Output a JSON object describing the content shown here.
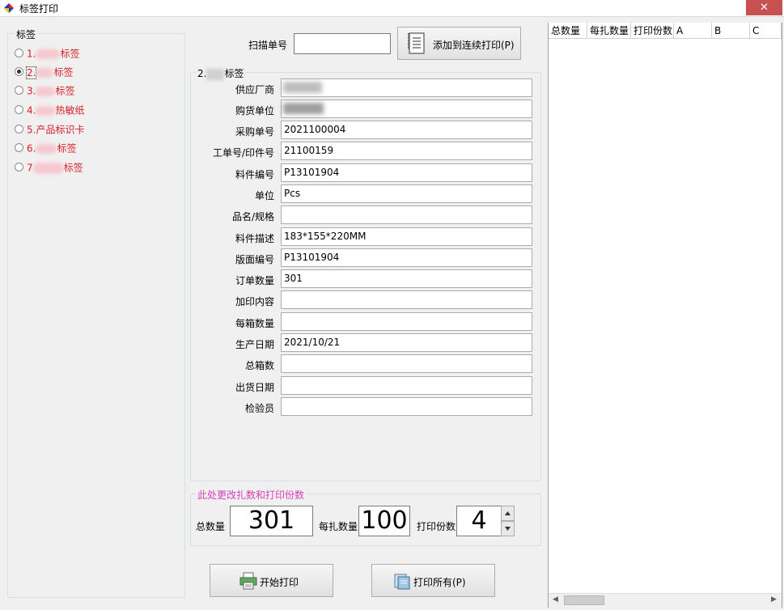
{
  "window": {
    "title": "标签打印",
    "close_symbol": "✕"
  },
  "label_group": {
    "legend": "标签",
    "items": [
      {
        "prefix": "1.",
        "suffix": "标签",
        "checked": false
      },
      {
        "prefix": "2.",
        "suffix": "标签",
        "checked": true
      },
      {
        "prefix": "3.",
        "suffix": "标签",
        "checked": false
      },
      {
        "prefix": "4.",
        "suffix": "热敏纸",
        "checked": false
      },
      {
        "prefix": "5.",
        "suffix": "产品标识卡",
        "checked": false
      },
      {
        "prefix": "6.",
        "suffix": "标签",
        "checked": false
      },
      {
        "prefix": "7",
        "suffix": "标签",
        "checked": false
      }
    ]
  },
  "scan": {
    "label": "扫描单号",
    "value": "",
    "add_button": "添加到连续打印(P)"
  },
  "detail_group": {
    "legend_prefix": "2.",
    "legend_suffix": "标签",
    "fields": [
      {
        "label": "供应厂商",
        "value": ""
      },
      {
        "label": "购货单位",
        "value": ""
      },
      {
        "label": "采购单号",
        "value": "2021100004"
      },
      {
        "label": "工单号/印件号",
        "value": "21100159"
      },
      {
        "label": "料件编号",
        "value": "P13101904"
      },
      {
        "label": "单位",
        "value": "Pcs"
      },
      {
        "label": "品名/规格",
        "value": ""
      },
      {
        "label": "料件描述",
        "value": "183*155*220MM"
      },
      {
        "label": "版面编号",
        "value": "P13101904"
      },
      {
        "label": "订单数量",
        "value": "301"
      },
      {
        "label": "加印内容",
        "value": ""
      },
      {
        "label": "每箱数量",
        "value": ""
      },
      {
        "label": "生产日期",
        "value": "2021/10/21"
      },
      {
        "label": "总箱数",
        "value": ""
      },
      {
        "label": "出货日期",
        "value": ""
      },
      {
        "label": "检验员",
        "value": ""
      }
    ]
  },
  "quantity_group": {
    "legend": "此处更改扎数和打印份数",
    "total_label": "总数量",
    "total_value": "301",
    "per_bundle_label": "每扎数量",
    "per_bundle_value": "100",
    "copies_label": "打印份数",
    "copies_value": "4"
  },
  "actions": {
    "start_print": "开始打印",
    "print_all": "打印所有(P)"
  },
  "grid": {
    "columns": [
      "总数量",
      "每扎数量",
      "打印份数",
      "A",
      "B",
      "C"
    ]
  },
  "colors": {
    "accent_red": "#d4202a",
    "legend_pink": "#d63fb9"
  }
}
